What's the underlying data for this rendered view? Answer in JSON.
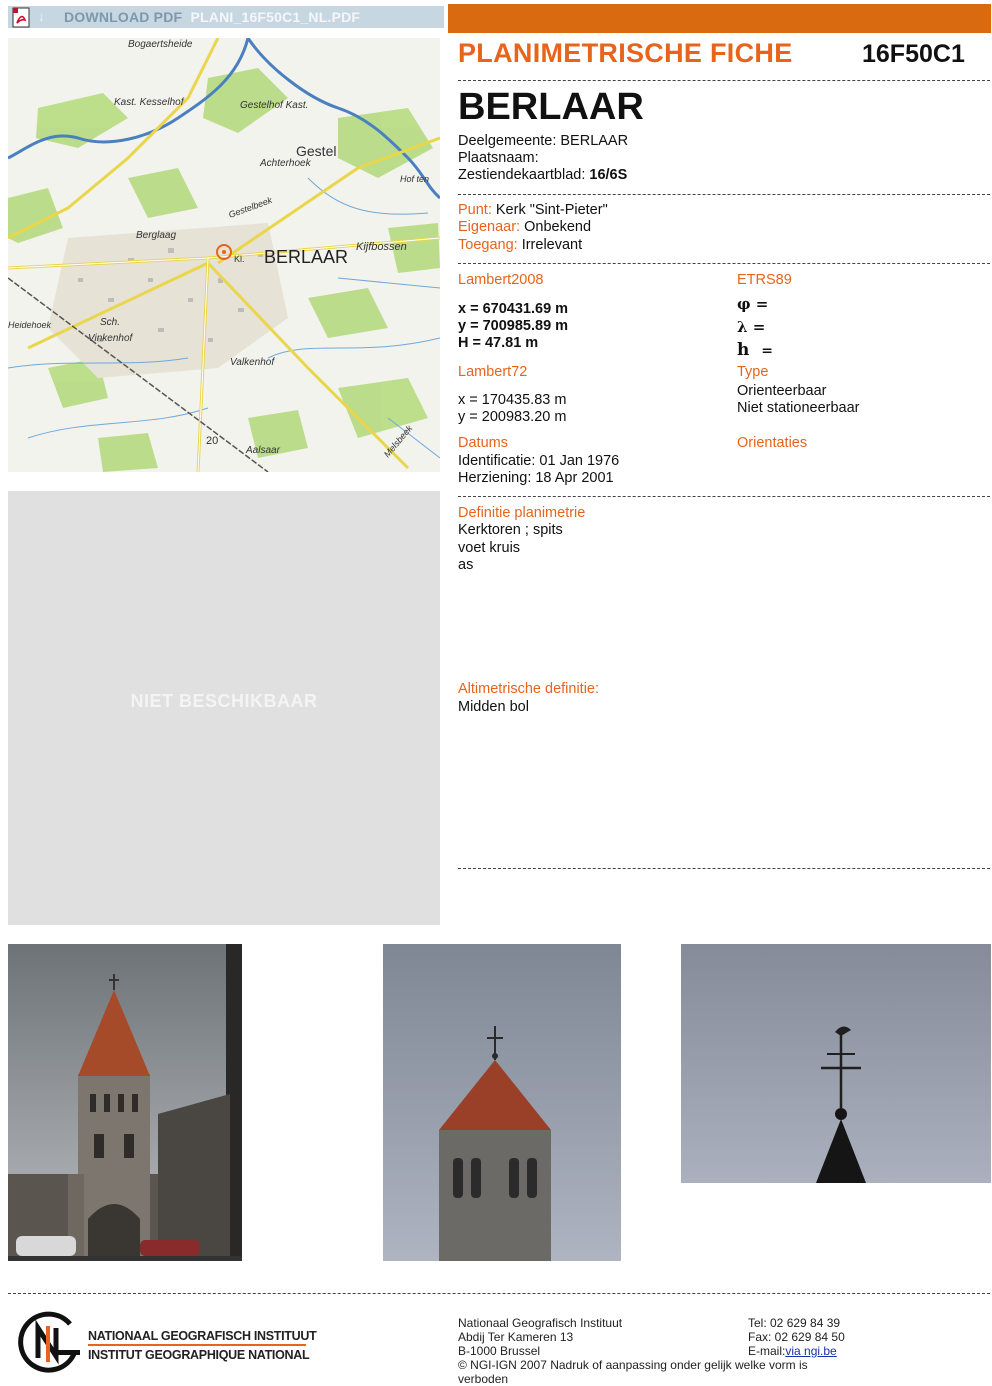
{
  "download_bar": {
    "label": "DOWNLOAD PDF",
    "filename": "PLANI_16F50C1_NL.PDF"
  },
  "fiche": {
    "title": "PLANIMETRISCHE FICHE",
    "code": "16F50C1",
    "place": "BERLAAR"
  },
  "location": {
    "deelgemeente_label": "Deelgemeente:",
    "deelgemeente_value": "BERLAAR",
    "plaatsnaam_label": "Plaatsnaam:",
    "plaatsnaam_value": "",
    "zestiendekaartblad_label": "Zestiendekaartblad:",
    "zestiendekaartblad_value": "16/6S"
  },
  "point": {
    "punt_label": "Punt:",
    "punt_value": "Kerk \"Sint-Pieter\"",
    "eigenaar_label": "Eigenaar:",
    "eigenaar_value": "Onbekend",
    "toegang_label": "Toegang:",
    "toegang_value": "Irrelevant"
  },
  "lambert2008": {
    "heading": "Lambert2008",
    "x": "x = 670431.69 m",
    "y": "y = 700985.89 m",
    "h": "H = 47.81 m"
  },
  "etrs89": {
    "heading": "ETRS89",
    "phi": "φ =",
    "lambda": "λ =",
    "h": "h",
    "h_eq": "="
  },
  "lambert72": {
    "heading": "Lambert72",
    "x": "x = 170435.83 m",
    "y": "y = 200983.20 m"
  },
  "type": {
    "heading": "Type",
    "line1": "Orienteerbaar",
    "line2": "Niet stationeerbaar"
  },
  "datums": {
    "heading": "Datums",
    "identificatie": "Identificatie: 01 Jan 1976",
    "herziening": "Herziening: 18 Apr 2001"
  },
  "orientaties": {
    "heading": "Orientaties"
  },
  "definitie": {
    "heading": "Definitie planimetrie",
    "lines": [
      "Kerktoren ; spits",
      "voet kruis",
      "as"
    ]
  },
  "altimetrie": {
    "heading": "Altimetrische definitie:",
    "value": "Midden bol"
  },
  "no_photo_text": "NIET BESCHIKBAAR",
  "map_labels": {
    "bogaertsheide": "Bogaertsheide",
    "kast_kessel": "Kast. Kesselhof",
    "gestelhof": "Gestelhof Kast.",
    "gestel": "Gestel",
    "achterhoek": "Achterhoek",
    "hof": "Hof ten",
    "bergsken": "Berglaag",
    "berlaar": "BERLAAR",
    "kijfbossen": "Kijfbossen",
    "kl": "Kl.",
    "valkenhof": "Valkenhof",
    "vinkenhof": "Vinkenhof",
    "aalsaar": "Aalsaar",
    "twenty": "20",
    "gestelbeek": "Gestelbeek",
    "melsbeek": "Melsbeek",
    "sch": "Sch.",
    "heidehoek": "Heidehoek"
  },
  "footer": {
    "logo_line1": "NATIONAAL GEOGRAFISCH INSTITUUT",
    "logo_line2": "INSTITUT GEOGRAPHIQUE NATIONAL",
    "org": "Nationaal Geografisch Instituut",
    "street": "Abdij Ter Kameren 13",
    "city": "B-1000 Brussel",
    "copyright": "© NGI-IGN 2007 Nadruk of aanpassing onder gelijk welke vorm is",
    "copyright2": "verboden",
    "tel": "Tel: 02 629 84 39",
    "fax": "Fax: 02 629 84 50",
    "email_label": "E-mail:",
    "email": "via ngi.be"
  },
  "colors": {
    "accent": "#e8631c",
    "bar": "#d96a10",
    "download_bar": "#c7d7e2"
  }
}
